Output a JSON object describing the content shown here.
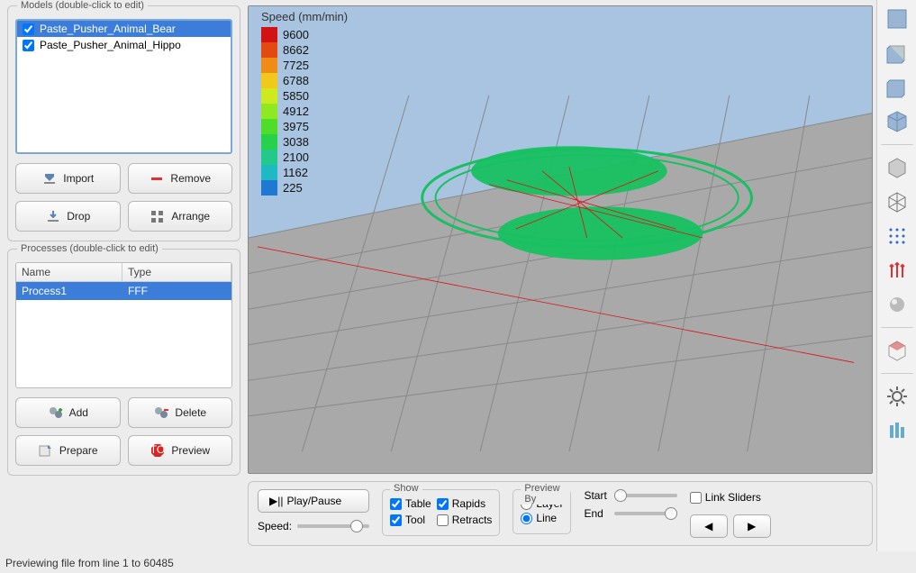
{
  "models_panel": {
    "title": "Models (double-click to edit)",
    "items": [
      {
        "checked": true,
        "label": "Paste_Pusher_Animal_Bear",
        "selected": true
      },
      {
        "checked": true,
        "label": "Paste_Pusher_Animal_Hippo",
        "selected": false
      }
    ],
    "buttons": {
      "import": "Import",
      "remove": "Remove",
      "drop": "Drop",
      "arrange": "Arrange"
    }
  },
  "processes_panel": {
    "title": "Processes (double-click to edit)",
    "headers": {
      "name": "Name",
      "type": "Type"
    },
    "rows": [
      {
        "name": "Process1",
        "type": "FFF",
        "selected": true
      }
    ],
    "buttons": {
      "add": "Add",
      "delete": "Delete",
      "prepare": "Prepare",
      "preview": "Preview"
    }
  },
  "viewport": {
    "legend_title": "Speed (mm/min)",
    "legend": [
      {
        "color": "#d11313",
        "value": "9600"
      },
      {
        "color": "#e24a12",
        "value": "8662"
      },
      {
        "color": "#ef8c17",
        "value": "7725"
      },
      {
        "color": "#f0c91a",
        "value": "6788"
      },
      {
        "color": "#cdea1f",
        "value": "5850"
      },
      {
        "color": "#8fe820",
        "value": "4912"
      },
      {
        "color": "#4edd28",
        "value": "3975"
      },
      {
        "color": "#27d14a",
        "value": "3038"
      },
      {
        "color": "#23c98a",
        "value": "2100"
      },
      {
        "color": "#1fb9c3",
        "value": "1162"
      },
      {
        "color": "#2078d3",
        "value": "225"
      }
    ]
  },
  "controls": {
    "play_pause": "Play/Pause",
    "speed_label": "Speed:",
    "show": {
      "title": "Show",
      "table": "Table",
      "rapids": "Rapids",
      "tool": "Tool",
      "retracts": "Retracts",
      "table_checked": true,
      "rapids_checked": true,
      "tool_checked": true,
      "retracts_checked": false
    },
    "preview_by": {
      "title": "Preview By",
      "layer": "Layer",
      "line": "Line",
      "selected": "line"
    },
    "start": "Start",
    "end": "End",
    "link_sliders": "Link Sliders"
  },
  "status": "Previewing file from line 1 to 60485",
  "right_tools": [
    "view-top",
    "view-front",
    "view-side",
    "view-iso",
    "sep",
    "cube-solid",
    "cube-wire",
    "points",
    "normals",
    "shading",
    "sep",
    "section",
    "sep",
    "settings",
    "supports"
  ]
}
